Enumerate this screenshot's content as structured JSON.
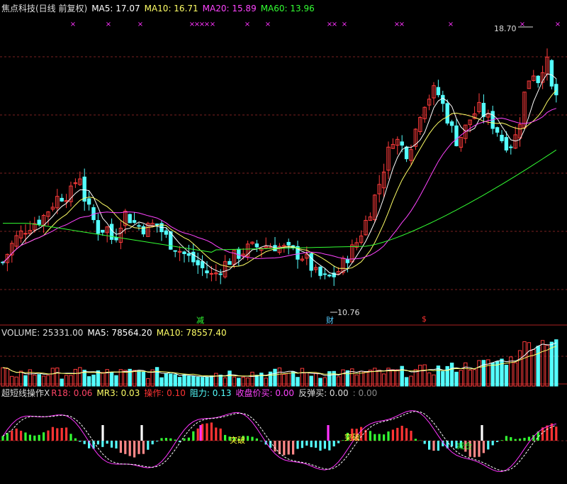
{
  "colors": {
    "bg": "#000000",
    "up": "#ff3b3b",
    "down": "#54ffff",
    "grid": "#7a1f1f",
    "ma5": "#ffffff",
    "ma10": "#ffff66",
    "ma20": "#ff44ff",
    "ma60": "#33ff33",
    "white": "#ffffff",
    "cyan": "#55ffff",
    "magenta": "#ff33ff",
    "orange": "#ff9933",
    "red": "#ff3333",
    "green": "#33ff33",
    "yellow": "#ffff33"
  },
  "header": {
    "title": "焦点科技(日线 前复权)",
    "ma5": "MA5: 17.07",
    "ma10": "MA10: 16.71",
    "ma20": "MA20: 15.89",
    "ma60": "MA60: 13.96"
  },
  "volume_header": {
    "volume": "VOLUME: 25331.00",
    "ma5": "MA5: 78564.20",
    "ma10": "MA10: 78557.40"
  },
  "indicator_header": {
    "name": "超短线操作X",
    "r18": "R18: 0.06",
    "mr3": "MR3: 0.03",
    "op": "操作: 0.10",
    "res": "阻力: 0.13",
    "close_buy": "收盘价买: 0.00",
    "rebound": "反弹买: 0.00",
    "extra": ": 0.00"
  },
  "markers": {
    "high": "18.70",
    "low": "10.76",
    "jian": "减",
    "cai": "财",
    "dollar": "$",
    "tupo1": "突破",
    "tupo2": "突破",
    "jianwei": "减仓"
  },
  "chart_data": {
    "type": "candlestick",
    "price_range": [
      9.5,
      20.0
    ],
    "price_high": 18.7,
    "price_low": 10.76,
    "ma_latest": {
      "MA5": 17.07,
      "MA10": 16.71,
      "MA20": 15.89,
      "MA60": 13.96
    },
    "volume_latest": 25331.0,
    "indicator_latest": {
      "R18": 0.06,
      "MR3": 0.03,
      "操作": 0.1,
      "阻力": 0.13,
      "收盘价买": 0.0,
      "反弹买": 0.0
    }
  }
}
